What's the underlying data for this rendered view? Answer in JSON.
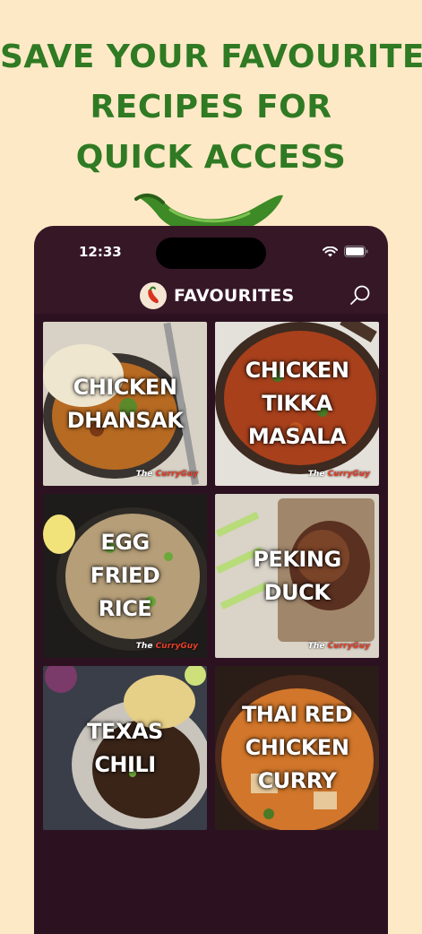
{
  "headline": {
    "lines": [
      "SAVE YOUR FAVOURITE",
      "RECIPES FOR",
      "QUICK ACCESS"
    ]
  },
  "status_bar": {
    "time": "12:33"
  },
  "nav": {
    "title": "FAVOURITES"
  },
  "brand": {
    "name": "CurryGuy",
    "prefix": "The"
  },
  "recipes": [
    {
      "label": "CHICKEN\nDHANSAK",
      "color": "#8a5a2c",
      "branded": true
    },
    {
      "label": "CHICKEN\nTIKKA\nMASALA",
      "color": "#9a3a1f",
      "branded": true
    },
    {
      "label": "EGG\nFRIED\nRICE",
      "color": "#7a6a45",
      "branded": true
    },
    {
      "label": "PEKING\nDUCK",
      "color": "#6b4a2e",
      "branded": true
    },
    {
      "label": "TEXAS\nCHILI",
      "color": "#4a3a30",
      "branded": false
    },
    {
      "label": "THAI RED\nCHICKEN\nCURRY",
      "color": "#b3641f",
      "branded": false
    }
  ],
  "colors": {
    "background": "#fde9c6",
    "headline": "#2f7a23",
    "phone": "#361726",
    "accent_red": "#e8412b"
  }
}
